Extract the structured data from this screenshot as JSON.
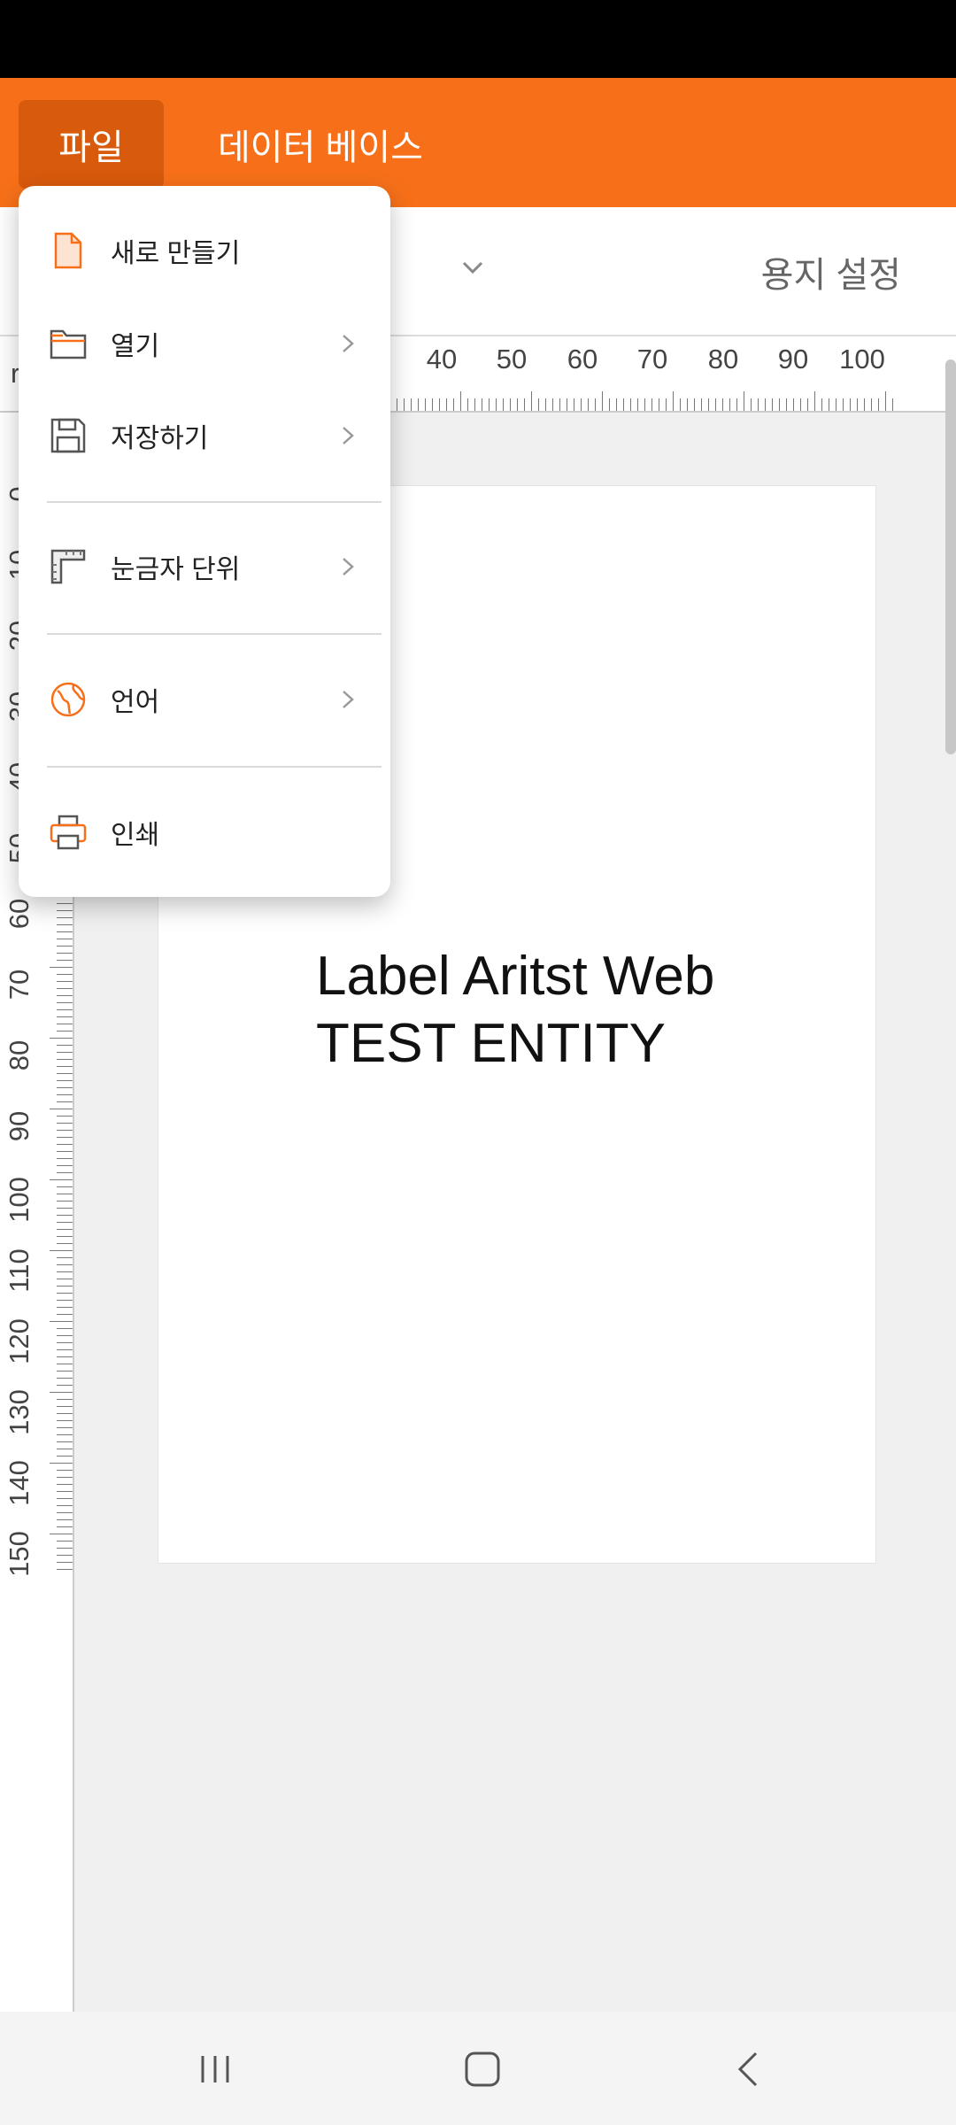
{
  "app_bar": {
    "tab_file": "파일",
    "tab_database": "데이터 베이스",
    "color": "#f77019",
    "active_tab_color": "#d85a0d"
  },
  "toolbar": {
    "paper_setting": "용지 설정"
  },
  "ruler": {
    "left_char": "r",
    "horizontal_labels": [
      "40",
      "50",
      "60",
      "70",
      "80",
      "90",
      "100"
    ],
    "vertical_labels": [
      "0",
      "10",
      "20",
      "30",
      "40",
      "50",
      "60",
      "70",
      "80",
      "90",
      "100",
      "110",
      "120",
      "130",
      "140",
      "150"
    ]
  },
  "canvas": {
    "label_text": "Label Aritst Web\nTEST ENTITY"
  },
  "file_menu": {
    "items": [
      {
        "label": "새로 만들기",
        "icon": "new-file-icon",
        "submenu": false
      },
      {
        "label": "열기",
        "icon": "folder-open-icon",
        "submenu": true
      },
      {
        "label": "저장하기",
        "icon": "save-icon",
        "submenu": true
      },
      {
        "label": "눈금자 단위",
        "icon": "ruler-icon",
        "submenu": true
      },
      {
        "label": "언어",
        "icon": "globe-icon",
        "submenu": true
      },
      {
        "label": "인쇄",
        "icon": "printer-icon",
        "submenu": false
      }
    ]
  },
  "nav_bar": {
    "icons": [
      "recents-icon",
      "home-icon",
      "back-icon"
    ]
  }
}
